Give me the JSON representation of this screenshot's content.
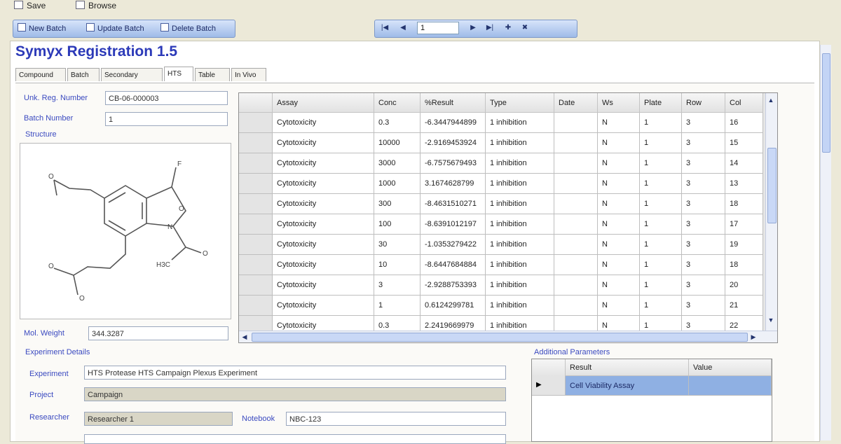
{
  "menu": {
    "items": [
      "Save",
      "Browse"
    ]
  },
  "toolbar": {
    "buttons": [
      "New Batch",
      "Update Batch",
      "Delete Batch"
    ],
    "nav_record": "1"
  },
  "app": {
    "title": "Symyx Registration 1.5"
  },
  "tabs": [
    {
      "label": "Compound",
      "active": false
    },
    {
      "label": "Batch",
      "active": false
    },
    {
      "label": "Secondary",
      "active": false
    },
    {
      "label": "HTS",
      "active": true
    },
    {
      "label": "Table",
      "active": false
    },
    {
      "label": "In Vivo",
      "active": false
    }
  ],
  "fields": {
    "reg_number": {
      "label": "Unk. Reg. Number",
      "value": "CB-06-000003"
    },
    "batch_number": {
      "label": "Batch Number",
      "value": "1"
    },
    "structure_label": "Structure",
    "mol_weight": {
      "label": "Mol. Weight",
      "value": "344.3287"
    },
    "experiment_details_label": "Experiment Details",
    "experiment": {
      "label": "Experiment",
      "value": "HTS Protease HTS Campaign Plexus Experiment"
    },
    "project": {
      "label": "Project",
      "value": "Campaign"
    },
    "researcher": {
      "label": "Researcher",
      "value": "Researcher 1"
    },
    "notebook": {
      "label": "Notebook",
      "value": "NBC-123"
    }
  },
  "grid": {
    "columns": [
      "Assay",
      "Conc",
      "%Result",
      "Type",
      "Date",
      "Ws",
      "Plate",
      "Row",
      "Col"
    ],
    "rows": [
      [
        "Cytotoxicity",
        "0.3",
        "-6.3447944899",
        "1 inhibition",
        "",
        "N",
        "1",
        "3",
        "16"
      ],
      [
        "Cytotoxicity",
        "10000",
        "-2.9169453924",
        "1 inhibition",
        "",
        "N",
        "1",
        "3",
        "15"
      ],
      [
        "Cytotoxicity",
        "3000",
        "-6.7575679493",
        "1 inhibition",
        "",
        "N",
        "1",
        "3",
        "14"
      ],
      [
        "Cytotoxicity",
        "1000",
        "3.1674628799",
        "1 inhibition",
        "",
        "N",
        "1",
        "3",
        "13"
      ],
      [
        "Cytotoxicity",
        "300",
        "-8.4631510271",
        "1 inhibition",
        "",
        "N",
        "1",
        "3",
        "18"
      ],
      [
        "Cytotoxicity",
        "100",
        "-8.6391012197",
        "1 inhibition",
        "",
        "N",
        "1",
        "3",
        "17"
      ],
      [
        "Cytotoxicity",
        "30",
        "-1.0353279422",
        "1 inhibition",
        "",
        "N",
        "1",
        "3",
        "19"
      ],
      [
        "Cytotoxicity",
        "10",
        "-8.6447684884",
        "1 inhibition",
        "",
        "N",
        "1",
        "3",
        "18"
      ],
      [
        "Cytotoxicity",
        "3",
        "-2.9288753393",
        "1 inhibition",
        "",
        "N",
        "1",
        "3",
        "20"
      ],
      [
        "Cytotoxicity",
        "1",
        "0.6124299781",
        "1 inhibition",
        "",
        "N",
        "1",
        "3",
        "21"
      ],
      [
        "Cytotoxicity",
        "0.3",
        "2.2419669979",
        "1 inhibition",
        "",
        "N",
        "1",
        "3",
        "22"
      ]
    ]
  },
  "additional": {
    "label": "Additional Parameters",
    "columns": [
      "Result",
      "Value"
    ],
    "rows": [
      [
        "Cell Viability Assay",
        ""
      ]
    ]
  },
  "colors": {
    "title": "#2b39b8",
    "label": "#3b4ac0",
    "selected_row": "#8fb0e3"
  },
  "icons": {
    "menu": "document-icon",
    "toolbar": "batch-icon",
    "nav": [
      "first-icon",
      "prev-icon",
      "next-icon",
      "last-icon",
      "add-icon",
      "delete-icon"
    ]
  }
}
